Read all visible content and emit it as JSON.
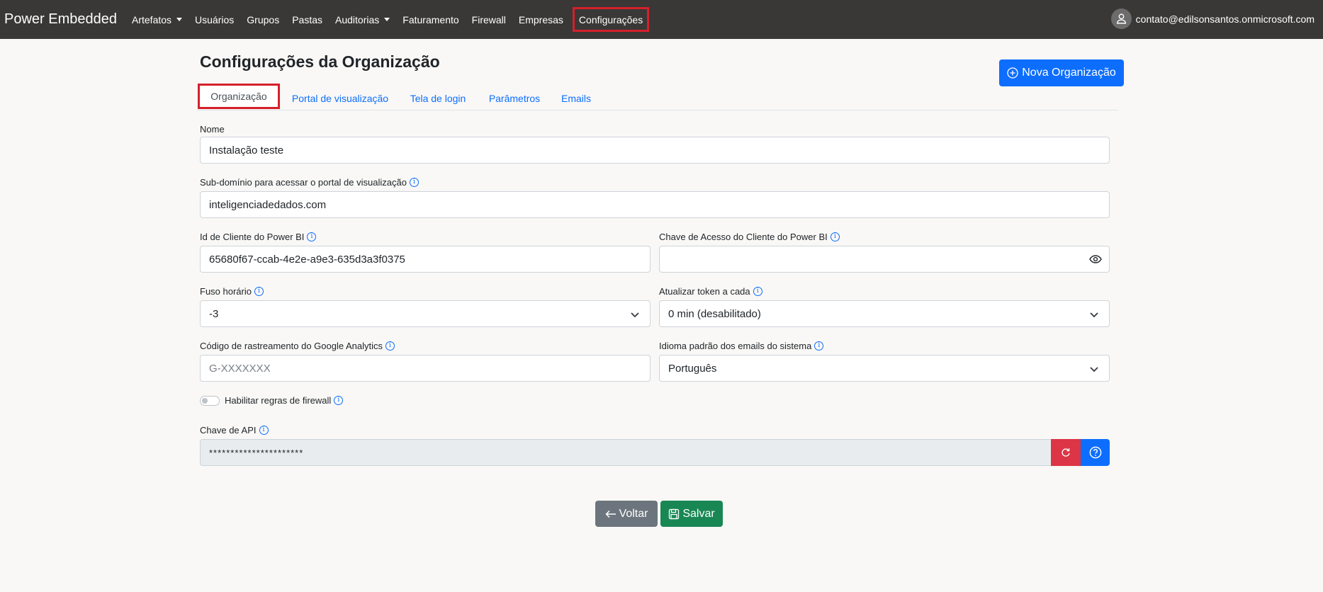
{
  "navbar": {
    "brand": "Power Embedded",
    "items": [
      {
        "label": "Artefatos",
        "dropdown": true
      },
      {
        "label": "Usuários"
      },
      {
        "label": "Grupos"
      },
      {
        "label": "Pastas"
      },
      {
        "label": "Auditorias",
        "dropdown": true
      },
      {
        "label": "Faturamento"
      },
      {
        "label": "Firewall"
      },
      {
        "label": "Empresas"
      },
      {
        "label": "Configurações",
        "highlighted": true
      }
    ],
    "user_email": "contato@edilsonsantos.onmicrosoft.com"
  },
  "page": {
    "title": "Configurações da Organização",
    "new_button": "Nova Organização"
  },
  "tabs": [
    {
      "label": "Organização",
      "active": true
    },
    {
      "label": "Portal de visualização"
    },
    {
      "label": "Tela de login"
    },
    {
      "label": "Parâmetros"
    },
    {
      "label": "Emails"
    }
  ],
  "form": {
    "name": {
      "label": "Nome",
      "value": "Instalação teste"
    },
    "subdomain": {
      "label": "Sub-domínio para acessar o portal de visualização",
      "value": "inteligenciadedados.com"
    },
    "client_id": {
      "label": "Id de Cliente do Power BI",
      "value": "65680f67-ccab-4e2e-a9e3-635d3a3f0375"
    },
    "client_secret": {
      "label": "Chave de Acesso do Cliente do Power BI",
      "value": ""
    },
    "timezone": {
      "label": "Fuso horário",
      "value": "-3"
    },
    "token_refresh": {
      "label": "Atualizar token a cada",
      "value": "0 min (desabilitado)"
    },
    "ga_code": {
      "label": "Código de rastreamento do Google Analytics",
      "placeholder": "G-XXXXXXX"
    },
    "email_language": {
      "label": "Idioma padrão dos emails do sistema",
      "value": "Português"
    },
    "firewall": {
      "label": "Habilitar regras de firewall",
      "enabled": false
    },
    "api_key": {
      "label": "Chave de API",
      "value": "**********************"
    }
  },
  "actions": {
    "back": "Voltar",
    "save": "Salvar"
  },
  "colors": {
    "navbar": "#393837",
    "primary": "#0d6efd",
    "danger": "#dc3545",
    "success": "#198754",
    "secondary": "#6c757d",
    "highlight": "#d5202a"
  }
}
